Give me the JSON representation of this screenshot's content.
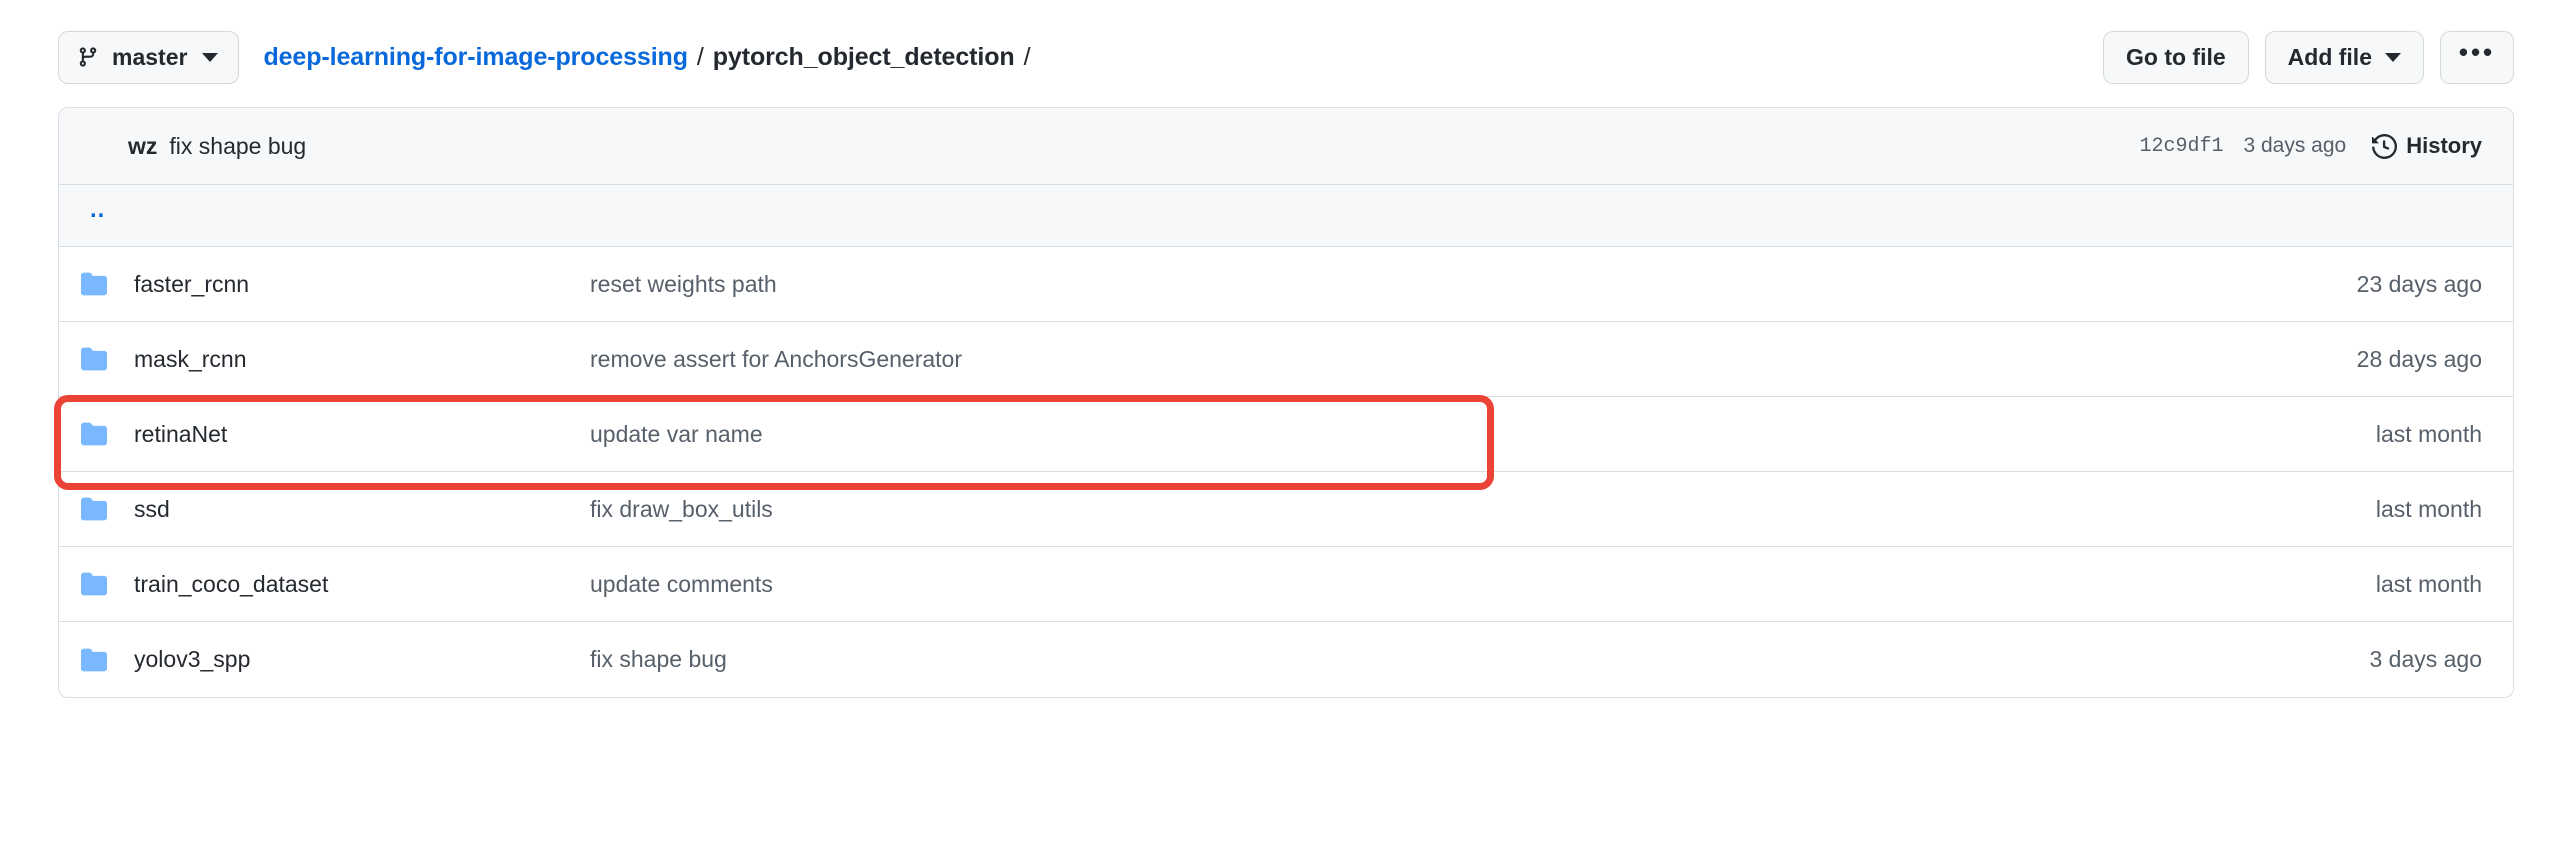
{
  "toolbar": {
    "branch": {
      "icon": "git-branch-icon",
      "label": "master",
      "caret": "chevron-down-icon"
    },
    "breadcrumb": {
      "repo": "deep-learning-for-image-processing",
      "separator": "/",
      "current": "pytorch_object_detection",
      "trailing_separator": "/"
    },
    "actions": {
      "go_to_file": "Go to file",
      "add_file": "Add file",
      "add_file_caret": "chevron-down-icon",
      "kebab": "•••"
    }
  },
  "commit_bar": {
    "author": "wz",
    "message": "fix shape bug",
    "sha": "12c9df1",
    "relative_time": "3 days ago",
    "history_icon": "history-clock-icon",
    "history_label": "History"
  },
  "file_list": {
    "parent_dir_label": "..",
    "rows": [
      {
        "icon": "folder-icon",
        "name": "faster_rcnn",
        "message": "reset weights path",
        "time": "23 days ago",
        "highlighted": false
      },
      {
        "icon": "folder-icon",
        "name": "mask_rcnn",
        "message": "remove assert for AnchorsGenerator",
        "time": "28 days ago",
        "highlighted": true
      },
      {
        "icon": "folder-icon",
        "name": "retinaNet",
        "message": "update var name",
        "time": "last month",
        "highlighted": false
      },
      {
        "icon": "folder-icon",
        "name": "ssd",
        "message": "fix draw_box_utils",
        "time": "last month",
        "highlighted": false
      },
      {
        "icon": "folder-icon",
        "name": "train_coco_dataset",
        "message": "update comments",
        "time": "last month",
        "highlighted": false
      },
      {
        "icon": "folder-icon",
        "name": "yolov3_spp",
        "message": "fix shape bug",
        "time": "3 days ago",
        "highlighted": false
      }
    ]
  },
  "annotation": {
    "type": "highlight-rectangle",
    "target_row": "mask_rcnn",
    "color": "#ec4337"
  },
  "colors": {
    "link": "#0969da",
    "text": "#24292f",
    "muted": "#57606a",
    "folder": "#79b8ff",
    "border": "#d8dee4",
    "header_bg": "#f6f8fa",
    "highlight": "#ec4337"
  }
}
